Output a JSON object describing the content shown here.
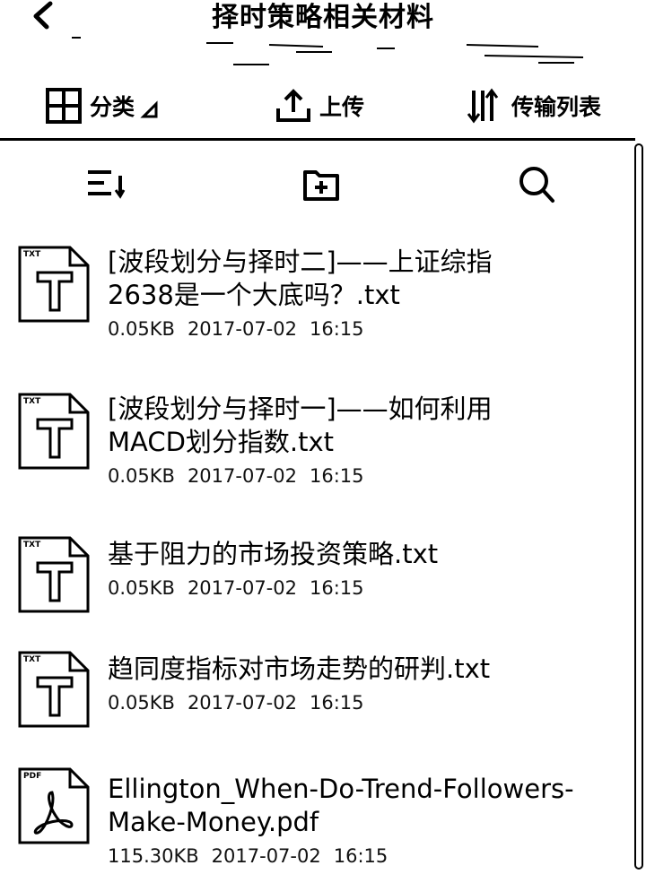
{
  "header": {
    "title": "择时策略相关材料"
  },
  "toolbar": {
    "category_label": "分类",
    "upload_label": "上传",
    "transfer_label": "传输列表"
  },
  "files": [
    {
      "name_lines": [
        "[波段划分与择时二]——上证综指",
        "2638是一个大底吗？.txt"
      ],
      "size": "0.05KB",
      "date": "2017-07-02",
      "time": "16:15",
      "type": "txt"
    },
    {
      "name_lines": [
        "[波段划分与择时一]——如何利用",
        "MACD划分指数.txt"
      ],
      "size": "0.05KB",
      "date": "2017-07-02",
      "time": "16:15",
      "type": "txt"
    },
    {
      "name_lines": [
        "基于阻力的市场投资策略.txt"
      ],
      "size": "0.05KB",
      "date": "2017-07-02",
      "time": "16:15",
      "type": "txt"
    },
    {
      "name_lines": [
        "趋同度指标对市场走势的研判.txt"
      ],
      "size": "0.05KB",
      "date": "2017-07-02",
      "time": "16:15",
      "type": "txt"
    },
    {
      "name_lines": [
        "Ellington_When-Do-Trend-Followers-",
        "Make-Money.pdf"
      ],
      "size": "115.30KB",
      "date": "2017-07-02",
      "time": "16:15",
      "type": "pdf"
    }
  ],
  "icons": {
    "back": "chevron-left-icon",
    "category": "grid-icon",
    "upload": "upload-icon",
    "transfer": "transfer-list-icon",
    "sort": "sort-icon",
    "new_folder": "new-folder-icon",
    "search": "search-icon",
    "txt": "txt-file-icon",
    "pdf": "pdf-file-icon"
  }
}
